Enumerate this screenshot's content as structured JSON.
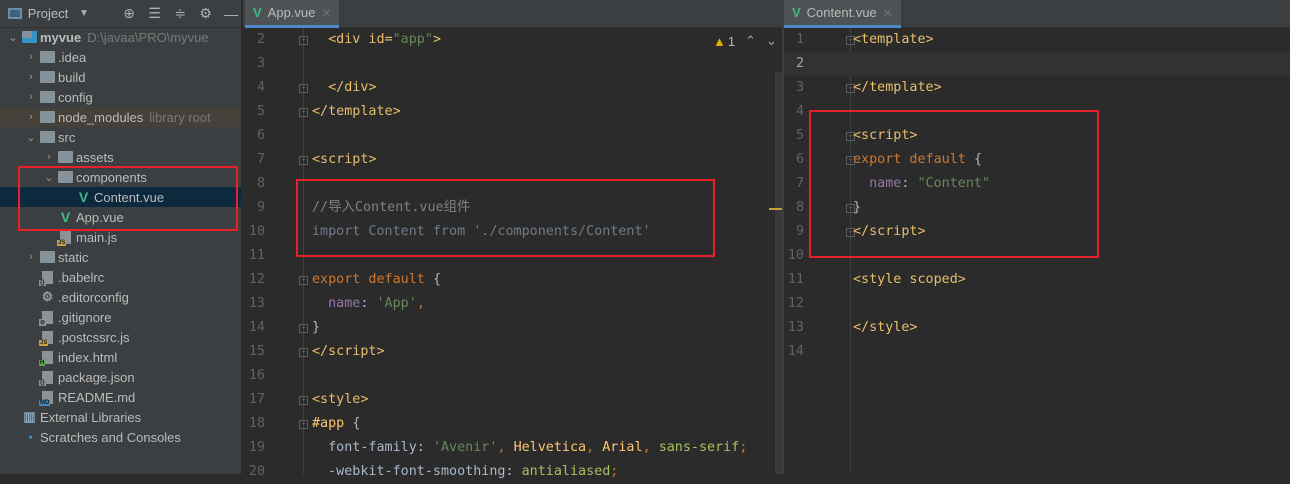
{
  "sidebar": {
    "title": "Project",
    "tools": [
      "locate-icon",
      "expand-all-icon",
      "collapse-all-icon",
      "gear-icon",
      "minimize-icon"
    ],
    "tree": [
      {
        "label": "myvue",
        "hint": "D:\\javaa\\PRO\\myvue",
        "level": 0,
        "type": "module",
        "chev": "open",
        "bold": true
      },
      {
        "label": ".idea",
        "level": 1,
        "type": "folder",
        "chev": "closed"
      },
      {
        "label": "build",
        "level": 1,
        "type": "folder",
        "chev": "closed"
      },
      {
        "label": "config",
        "level": 1,
        "type": "folder",
        "chev": "closed"
      },
      {
        "label": "node_modules",
        "hint": "library root",
        "level": 1,
        "type": "folder",
        "chev": "closed",
        "lib": true
      },
      {
        "label": "src",
        "level": 1,
        "type": "folder",
        "chev": "open"
      },
      {
        "label": "assets",
        "level": 2,
        "type": "folder",
        "chev": "closed"
      },
      {
        "label": "components",
        "level": 2,
        "type": "folder",
        "chev": "open"
      },
      {
        "label": "Content.vue",
        "level": 3,
        "type": "vue",
        "selected": true
      },
      {
        "label": "App.vue",
        "level": 2,
        "type": "vue"
      },
      {
        "label": "main.js",
        "level": 2,
        "type": "file",
        "badge": "JS",
        "badgeColor": "#c9a13a"
      },
      {
        "label": "static",
        "level": 1,
        "type": "folder",
        "chev": "closed"
      },
      {
        "label": ".babelrc",
        "level": 1,
        "type": "file",
        "badge": "{}",
        "badgeColor": "#8c9396"
      },
      {
        "label": ".editorconfig",
        "level": 1,
        "type": "gear"
      },
      {
        "label": ".gitignore",
        "level": 1,
        "type": "file",
        "badge": "⊘",
        "badgeColor": "#8c9396"
      },
      {
        "label": ".postcssrc.js",
        "level": 1,
        "type": "file",
        "badge": "JS",
        "badgeColor": "#c9a13a"
      },
      {
        "label": "index.html",
        "level": 1,
        "type": "file",
        "badge": "H",
        "badgeColor": "#59a14f"
      },
      {
        "label": "package.json",
        "level": 1,
        "type": "file",
        "badge": "{}",
        "badgeColor": "#8c9396"
      },
      {
        "label": "README.md",
        "level": 1,
        "type": "file",
        "badge": "MD",
        "badgeColor": "#3d8bb8"
      },
      {
        "label": "External Libraries",
        "level": 0,
        "type": "libs"
      },
      {
        "label": "Scratches and Consoles",
        "level": 0,
        "type": "scratch"
      }
    ]
  },
  "left_editor": {
    "tab": "App.vue",
    "warnings": "1",
    "first_line": 2,
    "current_line": null,
    "lines": [
      [
        [
          "  <div id=",
          "t"
        ],
        [
          "\"app\"",
          "s"
        ],
        [
          ">",
          "t"
        ]
      ],
      [],
      [
        [
          "  </div>",
          "t"
        ]
      ],
      [
        [
          "</template>",
          "t"
        ]
      ],
      [],
      [
        [
          "<script>",
          "t"
        ]
      ],
      [],
      [
        [
          "//导入Content.vue组件",
          "c"
        ]
      ],
      [
        [
          "import Content from './components/Content'",
          "u"
        ]
      ],
      [],
      [
        [
          "export default ",
          "k"
        ],
        [
          "{",
          "n"
        ]
      ],
      [
        [
          "  ",
          "n"
        ],
        [
          "name",
          "p"
        ],
        [
          ": ",
          "n"
        ],
        [
          "'App'",
          "s"
        ],
        [
          ",",
          "k"
        ]
      ],
      [
        [
          "}",
          "n"
        ]
      ],
      [
        [
          "</script>",
          "t"
        ]
      ],
      [],
      [
        [
          "<style>",
          "t"
        ]
      ],
      [
        [
          "#app ",
          "y"
        ],
        [
          "{",
          "n"
        ]
      ],
      [
        [
          "  font-family: ",
          "n"
        ],
        [
          "'Avenir'",
          "s"
        ],
        [
          ", ",
          "k"
        ],
        [
          "Helvetica",
          "y"
        ],
        [
          ", ",
          "k"
        ],
        [
          "Arial",
          "y"
        ],
        [
          ", ",
          "k"
        ],
        [
          "sans-serif",
          "g"
        ],
        [
          ";",
          "k"
        ]
      ],
      [
        [
          "  -webkit-font-smoothing: ",
          "n"
        ],
        [
          "antialiased",
          "g"
        ],
        [
          ";",
          "k"
        ]
      ]
    ],
    "folds": [
      2,
      4,
      5,
      7,
      12,
      14,
      15,
      17,
      18
    ]
  },
  "right_editor": {
    "tab": "Content.vue",
    "first_line": 1,
    "current_line": 2,
    "lines": [
      [
        [
          "<template>",
          "t"
        ]
      ],
      [],
      [
        [
          "</template>",
          "t"
        ]
      ],
      [],
      [
        [
          "<script>",
          "t"
        ]
      ],
      [
        [
          "export default ",
          "k"
        ],
        [
          "{",
          "n"
        ]
      ],
      [
        [
          "  ",
          "n"
        ],
        [
          "name",
          "p"
        ],
        [
          ": ",
          "n"
        ],
        [
          "\"Content\"",
          "s"
        ]
      ],
      [
        [
          "}",
          "n"
        ]
      ],
      [
        [
          "</script>",
          "t"
        ]
      ],
      [],
      [
        [
          "<style scoped>",
          "t"
        ]
      ],
      [],
      [
        [
          "</style>",
          "t"
        ]
      ],
      []
    ],
    "folds": [
      1,
      3,
      5,
      6,
      8,
      9
    ]
  }
}
